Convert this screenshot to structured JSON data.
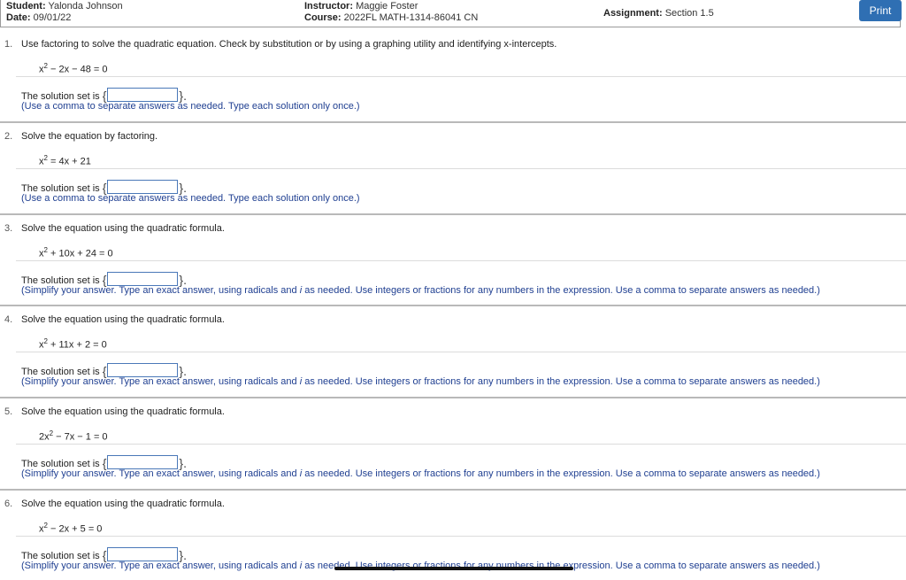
{
  "header": {
    "student_label": "Student:",
    "student_name": "Yalonda Johnson",
    "date_label": "Date:",
    "date_value": "09/01/22",
    "instructor_label": "Instructor:",
    "instructor_name": "Maggie Foster",
    "course_label": "Course:",
    "course_value": "2022FL MATH-1314-86041 CN",
    "assignment_label": "Assignment:",
    "assignment_value": "Section 1.5",
    "print_label": "Print"
  },
  "solution_prefix": "The solution set is",
  "questions": [
    {
      "num": "1.",
      "text": "Use factoring to solve the quadratic equation.  Check by substitution or by using a graphing utility and identifying x-intercepts.",
      "eq_a": "x",
      "eq_b": " − 2x − 48 = 0",
      "hint_pre": "(Use a comma to separate answers as needed. Type each solution only once.)",
      "hint_i": "",
      "hint_post": ""
    },
    {
      "num": "2.",
      "text": "Solve the equation by factoring.",
      "eq_a": "x",
      "eq_b": " = 4x + 21",
      "hint_pre": "(Use a comma to separate answers as needed. Type each solution only once.)",
      "hint_i": "",
      "hint_post": ""
    },
    {
      "num": "3.",
      "text": "Solve the equation using the quadratic formula.",
      "eq_a": "x",
      "eq_b": " + 10x + 24 = 0",
      "hint_pre": "(Simplify your answer. Type an exact answer, using radicals and ",
      "hint_i": "i",
      "hint_post": " as needed. Use integers or fractions for any numbers in the expression. Use a comma to separate answers as needed.)"
    },
    {
      "num": "4.",
      "text": "Solve the equation using the quadratic formula.",
      "eq_a": "x",
      "eq_b": " + 11x + 2 = 0",
      "hint_pre": "(Simplify your answer. Type an exact answer, using radicals and ",
      "hint_i": "i",
      "hint_post": " as needed. Use integers or fractions for any numbers in the expression. Use a comma to separate answers as needed.)"
    },
    {
      "num": "5.",
      "text": "Solve the equation using the quadratic formula.",
      "eq_a": "2x",
      "eq_b": " − 7x − 1 = 0",
      "hint_pre": "(Simplify your answer. Type an exact answer, using radicals and ",
      "hint_i": "i",
      "hint_post": " as needed. Use integers or fractions for any numbers in the expression. Use a comma to separate answers as needed.)"
    },
    {
      "num": "6.",
      "text": "Solve the equation using the quadratic formula.",
      "eq_a": "x",
      "eq_b": " − 2x + 5 = 0",
      "hint_pre": "(Simplify your answer. Type an exact answer, using radicals and ",
      "hint_i": "i",
      "hint_post": " as needed. Use integers or fractions for any numbers in the expression. Use a comma to separate answers as needed.)"
    }
  ],
  "exponent": "2",
  "brace_open": "{",
  "brace_close": "}."
}
